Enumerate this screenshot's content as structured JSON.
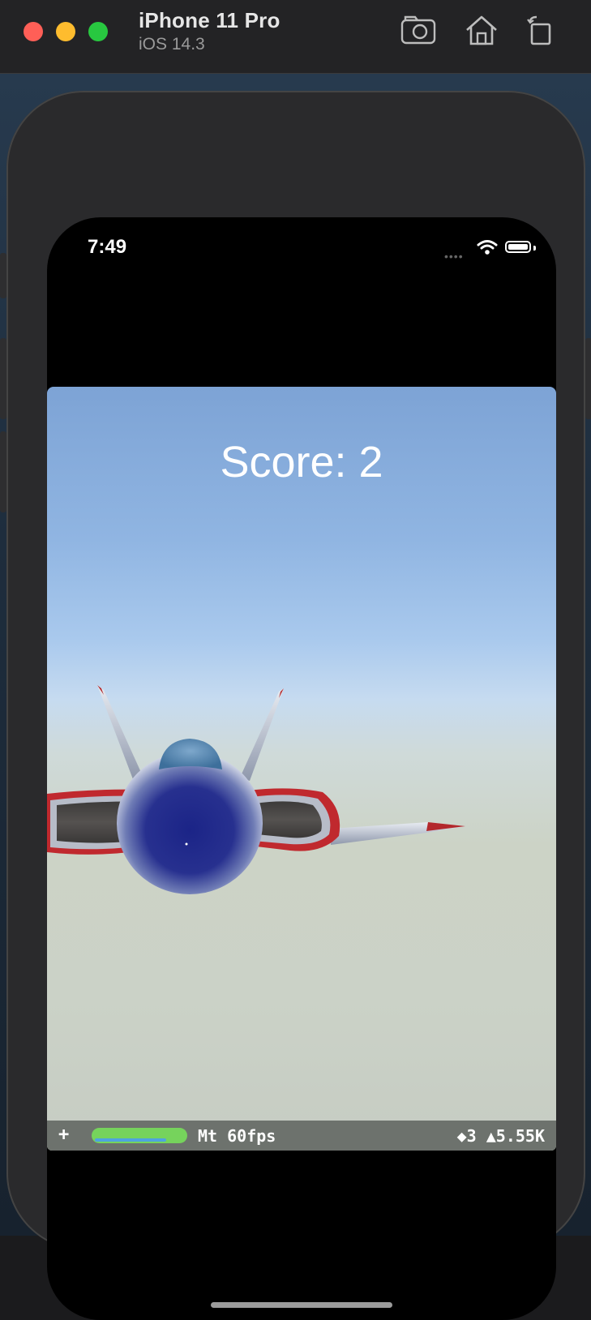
{
  "window": {
    "device_name": "iPhone 11 Pro",
    "os_version": "iOS 14.3",
    "buttons": {
      "screenshot_icon": "camera-icon",
      "home_icon": "home-icon",
      "rotate_icon": "rotate-icon"
    }
  },
  "status_bar": {
    "time": "7:49",
    "icons": [
      "signal-icon",
      "wifi-icon",
      "battery-icon"
    ]
  },
  "game": {
    "score_text": "Score: 2",
    "colors": {
      "sky_top": "#7da3d5",
      "horizon": "#c6dbf0",
      "ground": "#cbd2c7",
      "jet_canopy": "#1e2a8a",
      "intake_trim": "#c0292e"
    }
  },
  "stats": {
    "plus": "+",
    "fps": "Mt 60fps",
    "counts": "◆3 ▲5.55K",
    "bar_colors": {
      "main": "#76d35c",
      "sub": "#4fa3e0"
    }
  }
}
